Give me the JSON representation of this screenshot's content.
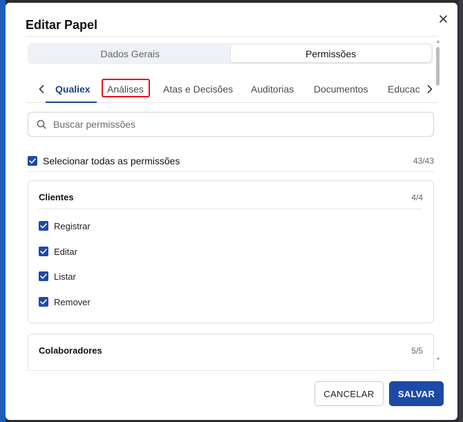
{
  "dialog": {
    "title": "Editar Papel",
    "close_icon": "close-icon"
  },
  "segments": [
    {
      "label": "Dados Gerais",
      "active": false
    },
    {
      "label": "Permissões",
      "active": true
    }
  ],
  "tabs": {
    "items": [
      {
        "label": "Qualiex",
        "active": true
      },
      {
        "label": "Análises",
        "active": false,
        "highlighted": true
      },
      {
        "label": "Atas e Decisões",
        "active": false
      },
      {
        "label": "Auditorias",
        "active": false
      },
      {
        "label": "Documentos",
        "active": false
      },
      {
        "label": "Educac",
        "active": false
      }
    ],
    "prev_icon": "chevron-left-icon",
    "next_icon": "chevron-right-icon"
  },
  "search": {
    "placeholder": "Buscar permissões",
    "value": "",
    "icon": "search-icon"
  },
  "select_all": {
    "label": "Selecionar todas as permissões",
    "count": "43/43",
    "checked": true
  },
  "groups": [
    {
      "title": "Clientes",
      "count": "4/4",
      "permissions": [
        {
          "label": "Registrar",
          "checked": true
        },
        {
          "label": "Editar",
          "checked": true
        },
        {
          "label": "Listar",
          "checked": true
        },
        {
          "label": "Remover",
          "checked": true
        }
      ]
    },
    {
      "title": "Colaboradores",
      "count": "5/5",
      "permissions": []
    }
  ],
  "footer": {
    "cancel_label": "CANCELAR",
    "save_label": "SALVAR"
  },
  "colors": {
    "accent": "#1c4aa6",
    "tab_active": "#1a3f8f",
    "highlight": "#e3131c"
  }
}
